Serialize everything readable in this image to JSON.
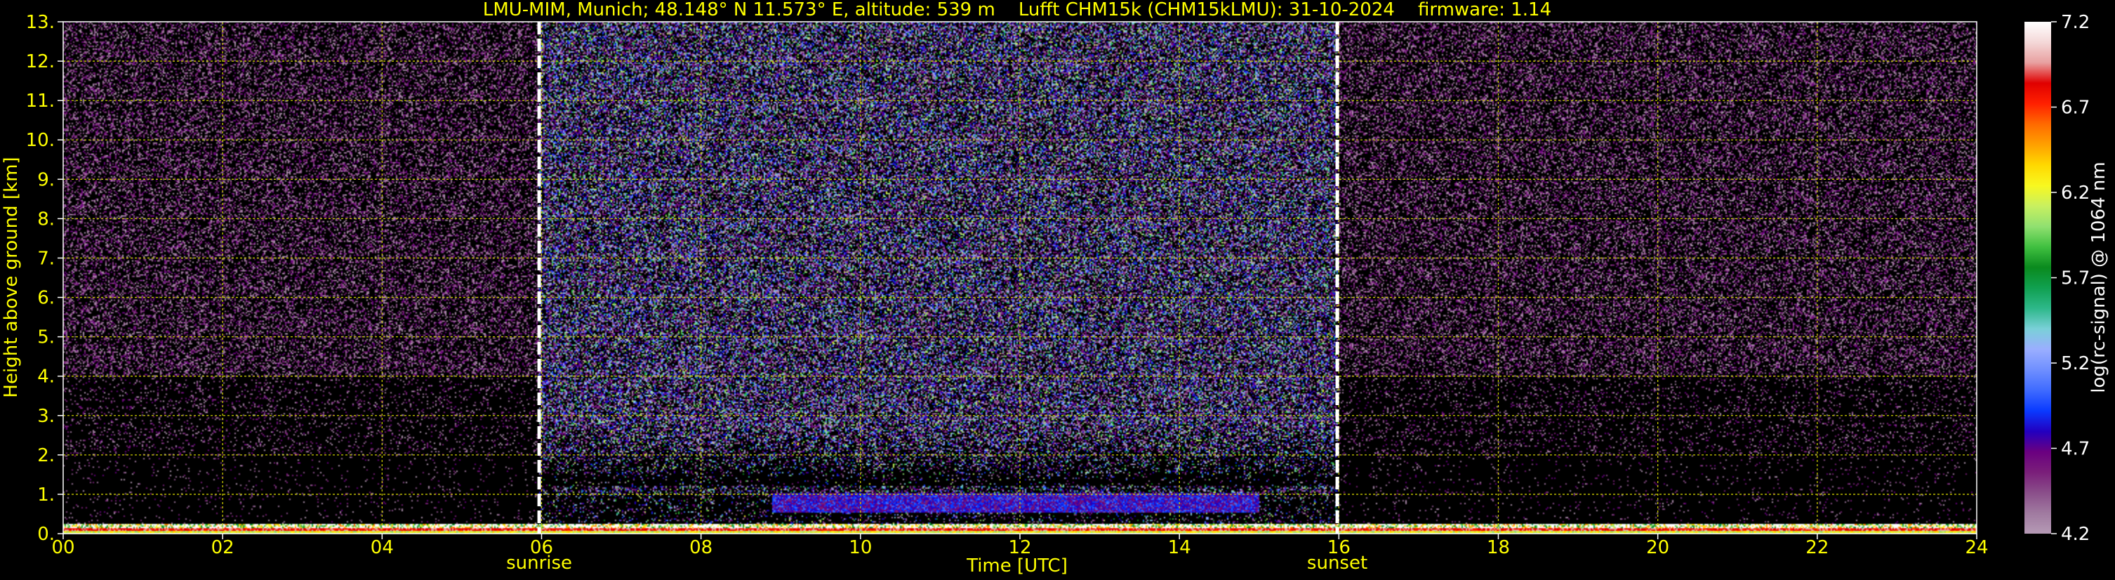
{
  "chart_data": {
    "type": "heatmap",
    "title": "LMU-MIM, Munich; 48.148° N 11.573° E, altitude: 539 m    Lufft CHM15k (CHM15kLMU): 31-10-2024    firmware: 1.14",
    "xlabel": "Time [UTC]",
    "ylabel": "Height above ground [km]",
    "xlim": [
      0,
      24
    ],
    "ylim": [
      0,
      13
    ],
    "x_ticks": [
      "00",
      "02",
      "04",
      "06",
      "08",
      "10",
      "12",
      "14",
      "16",
      "18",
      "20",
      "22",
      "24"
    ],
    "x_tick_values": [
      0,
      2,
      4,
      6,
      8,
      10,
      12,
      14,
      16,
      18,
      20,
      22,
      24
    ],
    "y_ticks": [
      "0.",
      "1.",
      "2.",
      "3.",
      "4.",
      "5.",
      "6.",
      "7.",
      "8.",
      "9.",
      "10.",
      "11.",
      "12.",
      "13."
    ],
    "y_tick_values": [
      0,
      1,
      2,
      3,
      4,
      5,
      6,
      7,
      8,
      9,
      10,
      11,
      12,
      13
    ],
    "grid": true,
    "colorbar": {
      "label": "log(rc-signal) @ 1064 nm",
      "range": [
        4.2,
        7.2
      ],
      "ticks": [
        "4.2",
        "4.7",
        "5.2",
        "5.7",
        "6.2",
        "6.7",
        "7.2"
      ],
      "tick_values": [
        4.2,
        4.7,
        5.2,
        5.7,
        6.2,
        6.7,
        7.2
      ],
      "colors": [
        "#b59ab5",
        "#a07aa0",
        "#8a4e8a",
        "#7a1e7a",
        "#6a0080",
        "#2200c0",
        "#0a3aff",
        "#3f6bff",
        "#6f8fff",
        "#9aaeff",
        "#7ad0d8",
        "#2eb88a",
        "#10a050",
        "#0a8a1e",
        "#40c040",
        "#90e070",
        "#c8f060",
        "#f8f820",
        "#ffd800",
        "#ffa000",
        "#ff6a00",
        "#ff2000",
        "#e00000",
        "#e8a0a0",
        "#f4d8d8",
        "#ffffff"
      ]
    },
    "annotations": [
      {
        "label": "sunrise",
        "x": 5.97
      },
      {
        "label": "sunset",
        "x": 15.98
      }
    ],
    "features": [
      {
        "name": "cloud layer",
        "x_range": [
          8.9,
          15.0
        ],
        "y_range": [
          0.55,
          1.05
        ],
        "level": 4.8
      },
      {
        "name": "surface layer",
        "x_range": [
          0,
          24
        ],
        "y_range": [
          0,
          0.25
        ],
        "level": 7.0
      }
    ]
  },
  "colors": {
    "background": "#000000",
    "text": "#ffff00",
    "grid": "#c8c800",
    "marker_line": "#ffffff"
  }
}
